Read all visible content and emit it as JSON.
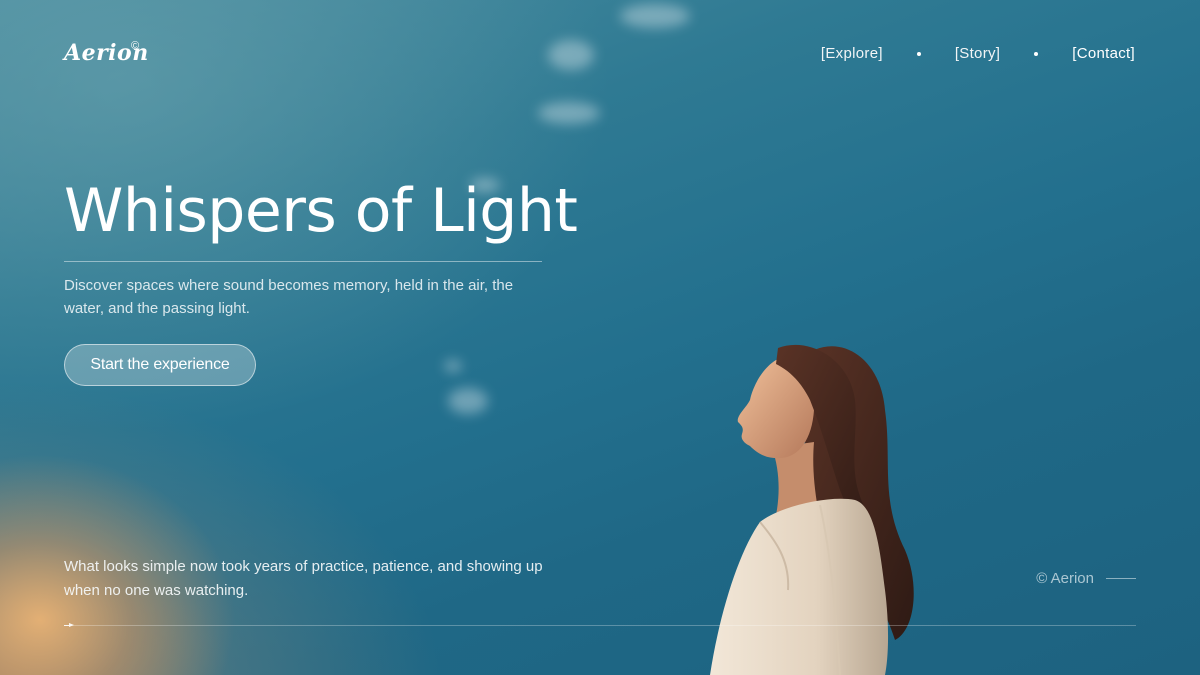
{
  "brand": {
    "logo": "Aerion",
    "logo_mark": "©"
  },
  "nav": {
    "items": [
      {
        "label": "[Explore]"
      },
      {
        "label": "[Story]"
      },
      {
        "label": "[Contact]"
      }
    ]
  },
  "hero": {
    "title": "Whispers of Light",
    "subtitle": "Discover spaces where sound becomes memory, held in the air, the water, and the passing light.",
    "cta_label": "Start the experience",
    "background_image": "woman-face-to-sky-photo"
  },
  "footer": {
    "quote": "What looks simple now took years of practice, patience, and showing up when no one was watching.",
    "copyright": "© Aerion",
    "progress": 0.005
  },
  "colors": {
    "sky": "#23708e",
    "sun_glow": "#e9b274",
    "text": "#ffffff"
  }
}
